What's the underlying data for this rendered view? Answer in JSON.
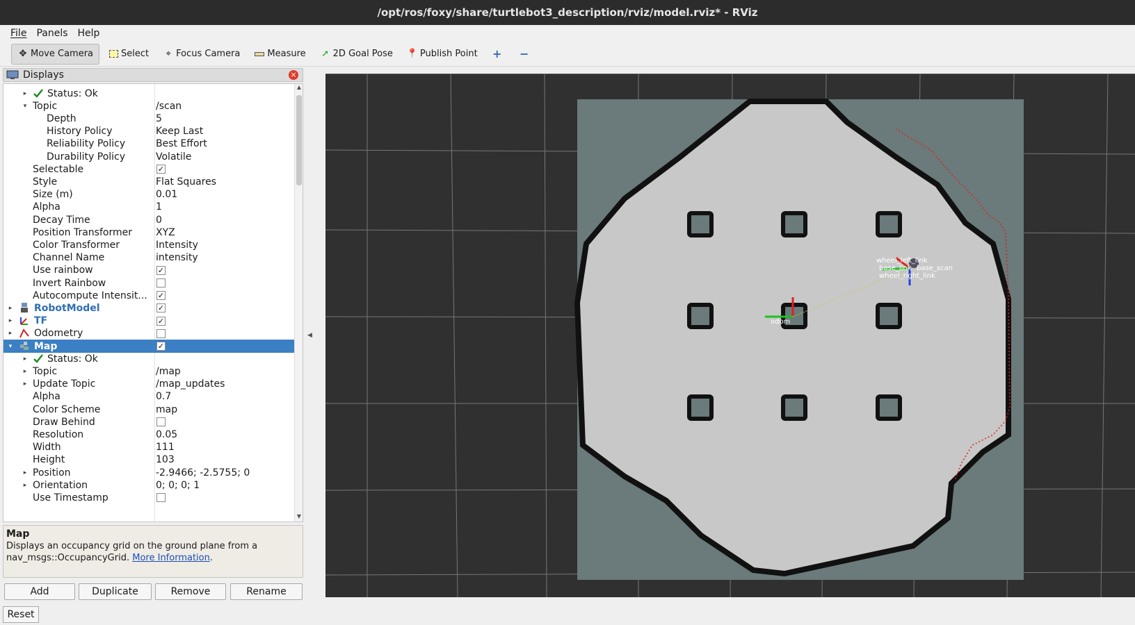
{
  "window": {
    "title": "/opt/ros/foxy/share/turtlebot3_description/rviz/model.rviz* - RViz"
  },
  "menu": {
    "items": [
      "File",
      "Panels",
      "Help"
    ]
  },
  "toolbar": {
    "tools": [
      {
        "label": "Move Camera",
        "icon": "move-camera-icon",
        "active": true
      },
      {
        "label": "Select",
        "icon": "select-icon"
      },
      {
        "label": "Focus Camera",
        "icon": "focus-camera-icon"
      },
      {
        "label": "Measure",
        "icon": "measure-icon"
      },
      {
        "label": "2D Goal Pose",
        "icon": "goal-pose-icon"
      },
      {
        "label": "Publish Point",
        "icon": "publish-point-icon"
      }
    ],
    "add_icon": "plus-icon",
    "remove_icon": "minus-icon"
  },
  "displays": {
    "title": "Displays",
    "rows": [
      {
        "name": "Status: Ok",
        "indent": 2,
        "arrow": "▸",
        "icon": "check-icon"
      },
      {
        "name": "Topic",
        "indent": 1,
        "arrow": "▾",
        "value": "/scan"
      },
      {
        "name": "Depth",
        "indent": 2,
        "value": "5"
      },
      {
        "name": "History Policy",
        "indent": 2,
        "value": "Keep Last"
      },
      {
        "name": "Reliability Policy",
        "indent": 2,
        "value": "Best Effort"
      },
      {
        "name": "Durability Policy",
        "indent": 2,
        "value": "Volatile"
      },
      {
        "name": "Selectable",
        "indent": 1,
        "check": true
      },
      {
        "name": "Style",
        "indent": 1,
        "value": "Flat Squares"
      },
      {
        "name": "Size (m)",
        "indent": 1,
        "value": "0.01"
      },
      {
        "name": "Alpha",
        "indent": 1,
        "value": "1"
      },
      {
        "name": "Decay Time",
        "indent": 1,
        "value": "0"
      },
      {
        "name": "Position Transformer",
        "indent": 1,
        "value": "XYZ"
      },
      {
        "name": "Color Transformer",
        "indent": 1,
        "value": "Intensity"
      },
      {
        "name": "Channel Name",
        "indent": 1,
        "value": "intensity"
      },
      {
        "name": "Use rainbow",
        "indent": 1,
        "check": true
      },
      {
        "name": "Invert Rainbow",
        "indent": 1,
        "check": false
      },
      {
        "name": "Autocompute Intensit...",
        "indent": 1,
        "check": true
      },
      {
        "name": "RobotModel",
        "indent": 0,
        "arrow": "▸",
        "icon": "robot-icon",
        "blue": true,
        "check": true
      },
      {
        "name": "TF",
        "indent": 0,
        "arrow": "▸",
        "icon": "tf-icon",
        "blue": true,
        "check": true
      },
      {
        "name": "Odometry",
        "indent": 0,
        "arrow": "▸",
        "icon": "odometry-icon",
        "check": false
      },
      {
        "name": "Map",
        "indent": 0,
        "arrow": "▾",
        "icon": "map-icon",
        "check": true,
        "selected": true
      },
      {
        "name": "Status: Ok",
        "indent": 2,
        "arrow": "▸",
        "icon": "check-icon"
      },
      {
        "name": "Topic",
        "indent": 1,
        "arrow": "▸",
        "value": "/map"
      },
      {
        "name": "Update Topic",
        "indent": 1,
        "arrow": "▸",
        "value": "/map_updates"
      },
      {
        "name": "Alpha",
        "indent": 1,
        "value": "0.7"
      },
      {
        "name": "Color Scheme",
        "indent": 1,
        "value": "map"
      },
      {
        "name": "Draw Behind",
        "indent": 1,
        "check": false
      },
      {
        "name": "Resolution",
        "indent": 1,
        "value": "0.05"
      },
      {
        "name": "Width",
        "indent": 1,
        "value": "111"
      },
      {
        "name": "Height",
        "indent": 1,
        "value": "103"
      },
      {
        "name": "Position",
        "indent": 1,
        "arrow": "▸",
        "value": "-2.9466; -2.5755; 0"
      },
      {
        "name": "Orientation",
        "indent": 1,
        "arrow": "▸",
        "value": "0; 0; 0; 1"
      },
      {
        "name": "Use Timestamp",
        "indent": 1,
        "check": false
      }
    ]
  },
  "description": {
    "title": "Map",
    "text": "Displays an occupancy grid on the ground plane from a nav_msgs::OccupancyGrid.",
    "link": "More Information",
    "after": "."
  },
  "buttons": {
    "add": "Add",
    "duplicate": "Duplicate",
    "remove": "Remove",
    "rename": "Rename",
    "reset": "Reset"
  },
  "viewport": {
    "frame_labels": [
      "odom",
      "wheel_left_link",
      "base_link",
      "wheel_right_link",
      "base_scan"
    ],
    "colors": {
      "background": "#303030",
      "map_unknown": "#6b7a7a",
      "map_free": "#c8c8c8",
      "map_occupied": "#111111",
      "grid": "#7a7a7a",
      "scan": "#e02020"
    }
  }
}
